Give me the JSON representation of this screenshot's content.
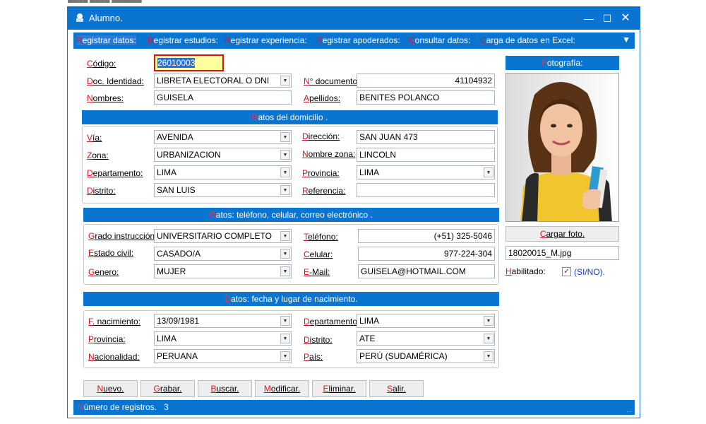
{
  "window": {
    "title": "Alumno."
  },
  "menu": [
    {
      "hk": "R",
      "rest": "egistrar datos:"
    },
    {
      "hk": "R",
      "rest": "egistrar estudios:"
    },
    {
      "hk": "R",
      "rest": "egistrar experiencia:"
    },
    {
      "hk": "R",
      "rest": "egistrar apoderados:"
    },
    {
      "hk": "C",
      "rest": "onsultar datos:"
    },
    {
      "hk": "C",
      "rest": "arga de datos en Excel:"
    }
  ],
  "header": {
    "codigo_label_hk": "C",
    "codigo_label_rest": "ódigo:",
    "codigo_value": "26010003",
    "doc_label_hk": "D",
    "doc_label_rest": "oc. Identidad:",
    "doc_value": "LIBRETA ELECTORAL O DNI",
    "ndoc_label_hk": "N",
    "ndoc_label_rest": "° documento:",
    "ndoc_value": "41104932",
    "nombres_label_hk": "N",
    "nombres_label_rest": "ombres:",
    "nombres_value": "GUISELA",
    "apellidos_label_hk": "A",
    "apellidos_label_rest": "pellidos:",
    "apellidos_value": "BENITES POLANCO"
  },
  "domicilio": {
    "title_hk": "D",
    "title_rest": "atos del domicilio .",
    "via_hk": "V",
    "via_rest": "ía:",
    "via_value": "AVENIDA",
    "direccion_hk": "D",
    "direccion_rest": "irección:",
    "direccion_value": "SAN JUAN 473",
    "zona_hk": "Z",
    "zona_rest": "ona:",
    "zona_value": "URBANIZACION",
    "nombrezona_hk": "N",
    "nombrezona_rest": "ombre zona:",
    "nombrezona_value": "LINCOLN",
    "depto_hk": "D",
    "depto_rest": "epartamento:",
    "depto_value": "LIMA",
    "provincia_hk": "P",
    "provincia_rest": "rovincia:",
    "provincia_value": "LIMA",
    "distrito_hk": "D",
    "distrito_rest": "istrito:",
    "distrito_value": "SAN LUIS",
    "referencia_hk": "R",
    "referencia_rest": "eferencia:",
    "referencia_value": ""
  },
  "contacto": {
    "title_hk": "D",
    "title_rest": "atos: teléfono, celular, correo electrónico .",
    "grado_hk": "G",
    "grado_rest": "rado instrucción:",
    "grado_value": "UNIVERSITARIO COMPLETO",
    "telefono_hk": "T",
    "telefono_rest": "eléfono:",
    "telefono_value": "(+51) 325-5046",
    "estado_hk": "E",
    "estado_rest": "stado civil:",
    "estado_value": "CASADO/A",
    "celular_hk": "C",
    "celular_rest": "elular:",
    "celular_value": "977-224-304",
    "genero_hk": "G",
    "genero_rest": "enero:",
    "genero_value": "MUJER",
    "email_hk": "E",
    "email_rest": "-Mail:",
    "email_value": "GUISELA@HOTMAIL.COM"
  },
  "nacimiento": {
    "title_hk": "D",
    "title_rest": "atos: fecha y lugar de nacimiento.",
    "fecha_hk": "F",
    "fecha_rest": ". nacimiento:",
    "fecha_value": "13/09/1981",
    "depto_hk": "D",
    "depto_rest": "epartamento:",
    "depto_value": "LIMA",
    "provincia_hk": "P",
    "provincia_rest": "rovincia:",
    "provincia_value": "LIMA",
    "distrito_hk": "D",
    "distrito_rest": "istrito:",
    "distrito_value": "ATE",
    "nacionalidad_hk": "N",
    "nacionalidad_rest": "acionalidad:",
    "nacionalidad_value": "PERUANA",
    "pais_hk": "P",
    "pais_rest": "aís:",
    "pais_value": "PERÚ (SUDAMÉRICA)"
  },
  "buttons": [
    {
      "hk": "N",
      "rest": "uevo."
    },
    {
      "hk": "G",
      "rest": "rabar."
    },
    {
      "hk": "B",
      "rest": "uscar."
    },
    {
      "hk": "M",
      "rest": "odificar."
    },
    {
      "hk": "E",
      "rest": "liminar."
    },
    {
      "hk": "S",
      "rest": "alir."
    }
  ],
  "photo_panel": {
    "title_hk": "F",
    "title_rest": "otografía:",
    "cargar_hk": "C",
    "cargar_rest": "argar foto.",
    "filename": "18020015_M.jpg",
    "habilitado_hk": "H",
    "habilitado_rest": "abilitado:",
    "habilitado_checked": true,
    "sino": "(SI/NO)."
  },
  "status": {
    "label_hk": "N",
    "label_rest": "úmero de registros.",
    "count": "3"
  },
  "colors": {
    "accent": "#0a74d1",
    "hotkey": "#d4141e",
    "highlight_fill": "#ffffa0"
  }
}
